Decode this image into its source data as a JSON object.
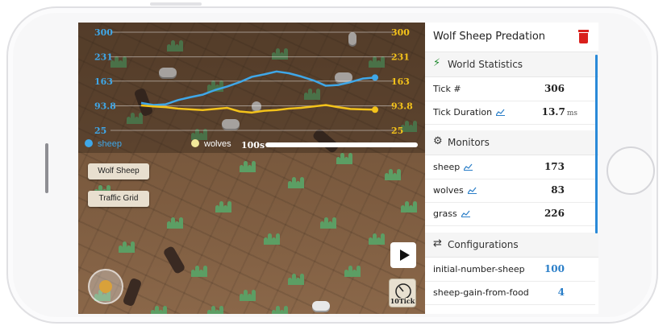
{
  "plot": {
    "y_ticks": [
      "300",
      "231",
      "163",
      "93.8",
      "25"
    ],
    "legend": {
      "sheep_label": "sheep",
      "wolves_label": "wolves",
      "sheep_color": "#3fa7e8",
      "wolves_color": "#f3c21a"
    },
    "time_label": "100s"
  },
  "chart_data": {
    "type": "line",
    "ylim": [
      25,
      300
    ],
    "y_ticks": [
      300,
      231,
      163,
      93.8,
      25
    ],
    "series": [
      {
        "name": "sheep",
        "color": "#3fa7e8",
        "values": [
          102,
          96,
          98,
          110,
          118,
          125,
          138,
          148,
          160,
          175,
          182,
          190,
          185,
          176,
          165,
          150,
          152,
          160,
          170,
          173
        ]
      },
      {
        "name": "wolves",
        "color": "#f3c21a",
        "values": [
          95,
          92,
          90,
          86,
          84,
          82,
          85,
          88,
          78,
          75,
          80,
          82,
          86,
          88,
          92,
          96,
          90,
          85,
          84,
          83
        ]
      }
    ]
  },
  "buttons": {
    "wolf_sheep": "Wolf Sheep",
    "traffic_grid": "Traffic Grid",
    "speed_label": "10Tick"
  },
  "panel": {
    "title": "Wolf Sheep Predation",
    "world_stats": {
      "header": "World Statistics",
      "tick_label": "Tick #",
      "tick_value": "306",
      "duration_label": "Tick Duration",
      "duration_value": "13.7",
      "duration_unit": "ms"
    },
    "monitors": {
      "header": "Monitors",
      "items": [
        {
          "label": "sheep",
          "value": "173"
        },
        {
          "label": "wolves",
          "value": "83"
        },
        {
          "label": "grass",
          "value": "226"
        }
      ]
    },
    "configurations": {
      "header": "Configurations",
      "items": [
        {
          "label": "initial-number-sheep",
          "value": "100"
        },
        {
          "label": "sheep-gain-from-food",
          "value": "4"
        }
      ]
    }
  }
}
